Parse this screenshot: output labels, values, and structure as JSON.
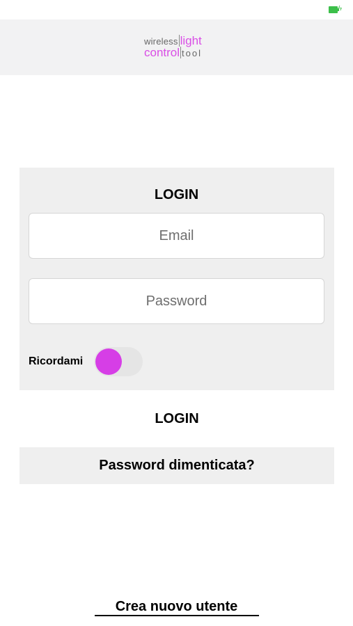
{
  "header": {
    "logo": {
      "line1_word": "wireless",
      "line1_accent": "light",
      "line2_accent": "control",
      "line2_word": "tool"
    }
  },
  "login_form": {
    "title": "LOGIN",
    "email_placeholder": "Email",
    "password_placeholder": "Password",
    "remember_label": "Ricordami",
    "remember_toggle_on": false,
    "accent_color": "#d63ee6"
  },
  "actions": {
    "login_label": "LOGIN",
    "forgot_label": "Password dimenticata?",
    "create_user_label": "Crea nuovo utente"
  },
  "status_bar": {
    "battery_icon": "battery-charging-icon",
    "battery_color": "#3cbf4a"
  }
}
